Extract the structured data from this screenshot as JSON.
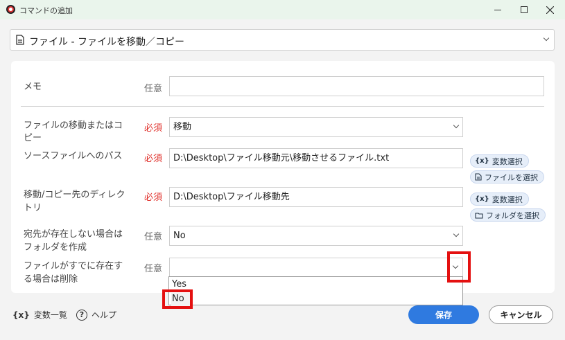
{
  "window": {
    "title": "コマンドの追加"
  },
  "command": {
    "selected": "ファイル - ファイルを移動／コピー"
  },
  "form": {
    "memo": {
      "label": "メモ",
      "tag": "任意",
      "value": ""
    },
    "move_or_copy": {
      "label1": "ファイルの移動またはコ",
      "label2": "ピー",
      "tag": "必須",
      "value": "移動"
    },
    "source_path": {
      "label": "ソースファイルへのパス",
      "tag": "必須",
      "value": "D:\\Desktop\\ファイル移動元\\移動させるファイル.txt"
    },
    "dest_dir": {
      "label1": "移動/コピー先のディレク",
      "label2": "トリ",
      "tag": "必須",
      "value": "D:\\Desktop\\ファイル移動先"
    },
    "create_folder": {
      "label1": "宛先が存在しない場合は",
      "label2": "フォルダを作成",
      "tag": "任意",
      "value": "No"
    },
    "delete_existing": {
      "label1": "ファイルがすでに存在す",
      "label2": "る場合は削除",
      "tag": "任意",
      "value": ""
    }
  },
  "chips": {
    "var_select_1": "変数選択",
    "file_select": "ファイルを選択",
    "var_select_2": "変数選択",
    "folder_select": "フォルダを選択",
    "var_icon": "{x}"
  },
  "dropdown": {
    "options": [
      "Yes",
      "No"
    ],
    "highlighted": "No"
  },
  "footer": {
    "vars_icon": "{x}",
    "vars_label": "変数一覧",
    "help_icon": "?",
    "help_label": "ヘルプ",
    "save": "保存",
    "cancel": "キャンセル"
  },
  "colors": {
    "accent": "#2f7ae0",
    "required": "#e0322d",
    "highlight": "#e41010"
  }
}
